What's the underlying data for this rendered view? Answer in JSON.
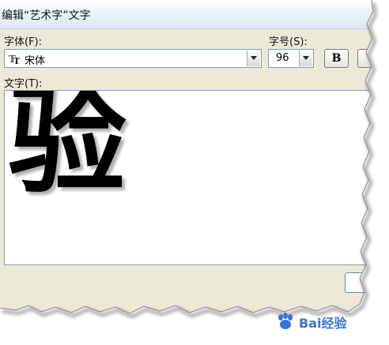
{
  "dialog": {
    "title": "编辑“艺术字”文字",
    "font_label": "字体(F):",
    "font_value": "宋体",
    "size_label": "字号(S):",
    "size_value": "96",
    "bold_label": "B",
    "text_label": "文字(T):",
    "text_value": "验"
  },
  "watermark": {
    "text": "Bai经验"
  },
  "colors": {
    "dialog_bg": "#ece9d8",
    "input_border": "#7f9db9",
    "watermark_blue": "#3b74d8"
  }
}
